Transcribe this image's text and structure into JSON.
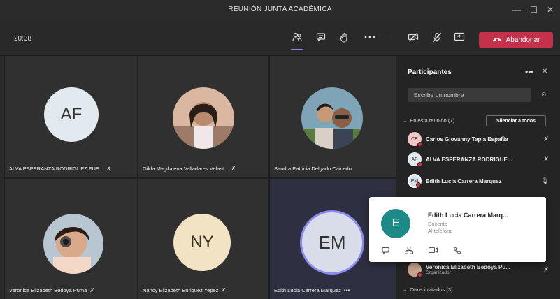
{
  "window": {
    "title": "REUNIÓN JUNTA ACADÉMICA",
    "minimize": "—",
    "maximize": "☐",
    "close": "✕"
  },
  "toolbar": {
    "time": "20:38",
    "leave_label": "Abandonar",
    "icons": {
      "participants": "participants-icon",
      "chat": "chat-icon",
      "raise_hand": "raise-hand-icon",
      "more": "more-icon",
      "camera": "camera-off-icon",
      "mic": "mic-off-icon",
      "share": "share-icon",
      "phone": "phone-icon"
    }
  },
  "tiles": [
    {
      "name": "ALVA ESPERANZA RODRIGUEZ FUE...",
      "initials": "AF",
      "muted": true
    },
    {
      "name": "Gilda Magdalena Valladares Velast...",
      "initials": "",
      "muted": true
    },
    {
      "name": "Sandra Patricia Delgado Caicedo",
      "initials": "",
      "muted": false
    },
    {
      "name": "Veronica Elizabeth Bedoya Puma",
      "initials": "",
      "muted": true
    },
    {
      "name": "Nancy Elizabeth Enriquez Yepez",
      "initials": "NY",
      "muted": true
    },
    {
      "name": "Edith Lucia Carrera Marquez",
      "initials": "EM",
      "more": "•••"
    }
  ],
  "panel": {
    "title": "Participantes",
    "more": "•••",
    "close": "✕",
    "search_placeholder": "Escribe un nombre",
    "in_meeting_label": "En esta reunión (7)",
    "mute_all_label": "Silenciar a todos",
    "participants": [
      {
        "initials": "CE",
        "name": "Carlos Giovanny Tapia EspaÑa"
      },
      {
        "initials": "AF",
        "name": "ALVA ESPERANZA RODRIGUE..."
      },
      {
        "initials": "EM",
        "name": "Edith Lucia Carrera Marquez"
      },
      {
        "initials": "",
        "name": "Veronica Elizabeth Bedoya Pu...",
        "role": "Organizador"
      }
    ],
    "others_label": "Otros invitados (3)"
  },
  "card": {
    "initial": "E",
    "name": "Edith Lucia Carrera Marq...",
    "role": "Docente",
    "status": "Al teléfono"
  },
  "colors": {
    "leave": "#c4314b",
    "accent": "#8b8cf0",
    "card_avatar": "#1d8a87",
    "badge": "#d13438"
  }
}
